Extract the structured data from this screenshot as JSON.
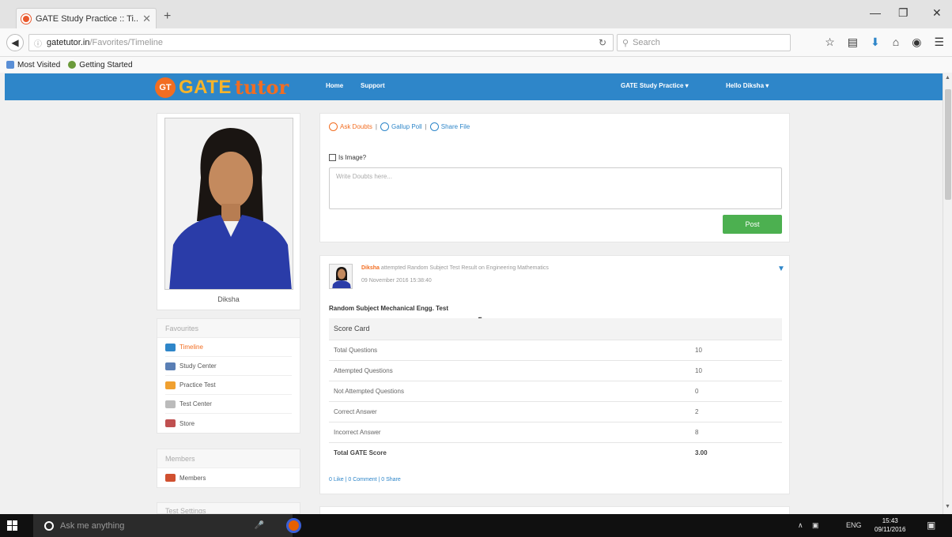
{
  "browser": {
    "tab_title": "GATE Study Practice :: Ti...",
    "tab_close": "✕",
    "new_tab": "+",
    "url_host": "gatetutor.in",
    "url_path": "/Favorites/Timeline",
    "search_placeholder": "Search",
    "window_controls": {
      "minimize": "—",
      "restore": "❐",
      "close": "✕"
    },
    "bookmarks": [
      "Most Visited",
      "Getting Started"
    ]
  },
  "site": {
    "logo_badge": "GT",
    "logo_gate": "GATE",
    "logo_tutor": "tutor",
    "nav": {
      "home": "Home",
      "support": "Support",
      "practice_menu": "GATE Study Practice ▾",
      "user_menu": "Hello Diksha ▾"
    }
  },
  "profile": {
    "name": "Diksha"
  },
  "favourites": {
    "heading": "Favourites",
    "items": [
      {
        "label": "Timeline",
        "color": "#2e86c9"
      },
      {
        "label": "Study Center",
        "color": "#5a7fb5"
      },
      {
        "label": "Practice Test",
        "color": "#f0a030"
      },
      {
        "label": "Test Center",
        "color": "#888888"
      },
      {
        "label": "Store",
        "color": "#c05050"
      }
    ]
  },
  "members": {
    "heading": "Members",
    "items": [
      {
        "label": "Members",
        "color": "#d05030"
      }
    ]
  },
  "test_settings": {
    "heading": "Test Settings"
  },
  "composer": {
    "actions": [
      "Ask Doubts",
      "Gallup Poll",
      "Share File"
    ],
    "separator": "|",
    "is_image_label": "Is Image?",
    "placeholder": "Write Doubts here...",
    "post_button": "Post"
  },
  "feed": {
    "user": "Diksha",
    "activity": "attempted Random Subject Test Result on Engineering Mathematics",
    "date": "09 November 2016 15:38:40",
    "test_name": "Random Subject Mechanical Engg. Test",
    "scorecard_title": "Score Card",
    "rows": [
      {
        "label": "Total Questions",
        "value": "10"
      },
      {
        "label": "Attempted Questions",
        "value": "10"
      },
      {
        "label": "Not Attempted Questions",
        "value": "0"
      },
      {
        "label": "Correct Answer",
        "value": "2"
      },
      {
        "label": "Incorrect Answer",
        "value": "8"
      }
    ],
    "total": {
      "label": "Total GATE Score",
      "value": "3.00"
    },
    "social": "0 Like | 0 Comment | 0 Share"
  },
  "taskbar": {
    "search_placeholder": "Ask me anything",
    "lang": "ENG",
    "time": "15:43",
    "date": "09/11/2016"
  },
  "colors": {
    "header_blue": "#2e86c9",
    "accent_orange": "#f26d21",
    "post_green": "#4cb050"
  }
}
